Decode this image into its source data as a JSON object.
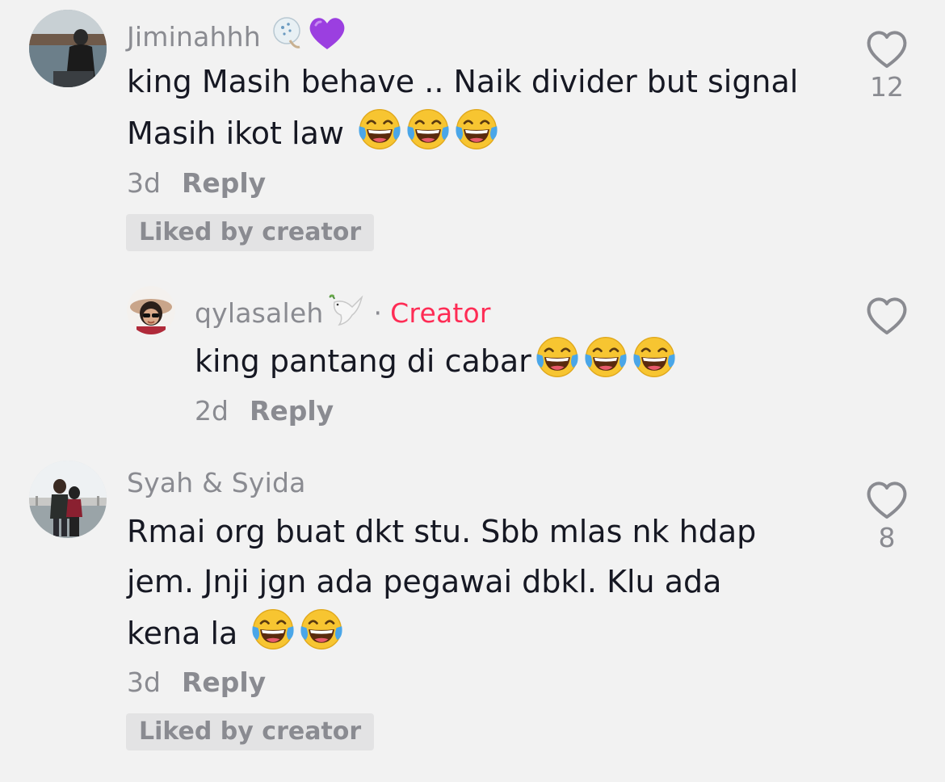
{
  "comments": [
    {
      "username": "Jiminahhh",
      "text_line1": "king Masih behave .. Naik divider but signal",
      "text_line2": "Masih ikot law",
      "time": "3d",
      "reply_label": "Reply",
      "liked_badge": "Liked by creator",
      "like_count": "12",
      "username_icons": [
        "flower-bubble-icon",
        "purple-heart-icon"
      ],
      "emojis": [
        "laughing-tears-emoji",
        "laughing-tears-emoji",
        "laughing-tears-emoji"
      ]
    },
    {
      "username": "qylasaleh",
      "creator_tag": "Creator",
      "separator": "·",
      "text_line1": "king pantang di cabar",
      "time": "2d",
      "reply_label": "Reply",
      "username_icons": [
        "dove-icon"
      ],
      "emojis": [
        "laughing-tears-emoji",
        "laughing-tears-emoji",
        "laughing-tears-emoji"
      ]
    },
    {
      "username": "Syah & Syida",
      "text_line1": "Rmai org buat dkt stu. Sbb mlas nk hdap",
      "text_line2": "jem. Jnji jgn ada pegawai dbkl. Klu ada",
      "text_line3": "kena la",
      "time": "3d",
      "reply_label": "Reply",
      "liked_badge": "Liked by creator",
      "like_count": "8",
      "emojis": [
        "laughing-tears-emoji",
        "laughing-tears-emoji"
      ]
    }
  ],
  "colors": {
    "background": "#f2f2f2",
    "text": "#161823",
    "muted": "#8a8b91",
    "creator": "#fe2c55",
    "badge_bg": "#e3e3e4"
  }
}
